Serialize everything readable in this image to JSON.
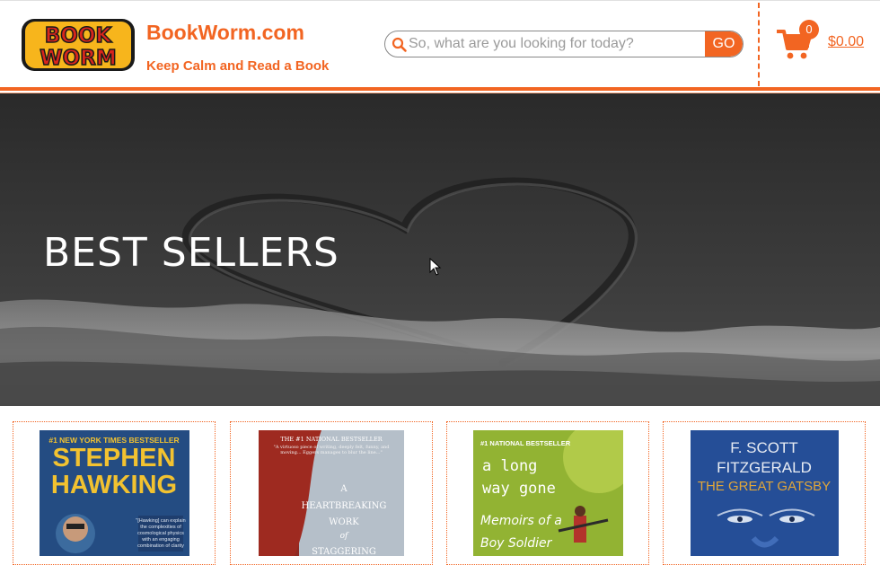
{
  "header": {
    "logo_text": "BOOK WORM",
    "site_name": "BookWorm.com",
    "tagline": "Keep Calm and Read a Book",
    "search": {
      "placeholder": "So, what are you looking for today?",
      "go_label": "GO",
      "icon": "search-icon"
    },
    "cart": {
      "icon": "cart-icon",
      "count": "0",
      "total": "$0.00"
    }
  },
  "hero": {
    "title": "BEST SELLERS"
  },
  "colors": {
    "accent": "#f26522",
    "hero_bg": "#3a3a3a"
  },
  "books": [
    {
      "author": "STEPHEN HAWKING",
      "top_text": "#1 NEW YORK TIMES BESTSELLER"
    },
    {
      "author": "",
      "top_text": "THE #1 NATIONAL BESTSELLER",
      "title_lines": [
        "A",
        "HEARTBREAKING",
        "WORK",
        "OF",
        "STAGGERING"
      ]
    },
    {
      "top_text": "#1 NATIONAL BESTSELLER",
      "title_lines": [
        "a long",
        "way gone",
        "Memoirs of a",
        "Boy Soldier"
      ]
    },
    {
      "author": "F. SCOTT FITZGERALD",
      "title": "THE GREAT GATSBY"
    }
  ]
}
